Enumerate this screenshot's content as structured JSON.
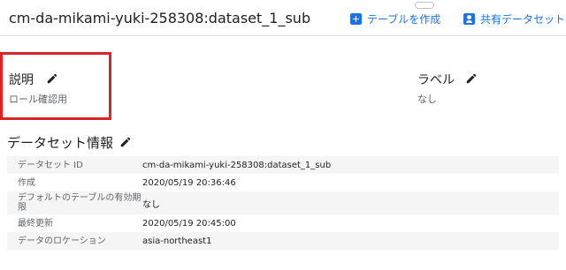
{
  "header": {
    "title": "cm-da-mikami-yuki-258308:dataset_1_sub",
    "create_table_label": "テーブルを作成",
    "share_dataset_label": "共有データセット"
  },
  "description": {
    "label": "説明",
    "value": "ロール確認用"
  },
  "labels": {
    "label": "ラベル",
    "value": "なし"
  },
  "dataset_info": {
    "heading": "データセット情報",
    "rows": [
      {
        "key": "データセット ID",
        "value": "cm-da-mikami-yuki-258308:dataset_1_sub"
      },
      {
        "key": "作成",
        "value": "2020/05/19 20:36:46"
      },
      {
        "key": "デフォルトのテーブルの有効期限",
        "value": "なし"
      },
      {
        "key": "最終更新",
        "value": "2020/05/19 20:45:00"
      },
      {
        "key": "データのロケーション",
        "value": "asia-northeast1"
      }
    ]
  },
  "colors": {
    "accent": "#1a73e8",
    "highlight_border": "#d9242a",
    "row_stripe": "#f5f5f5"
  }
}
